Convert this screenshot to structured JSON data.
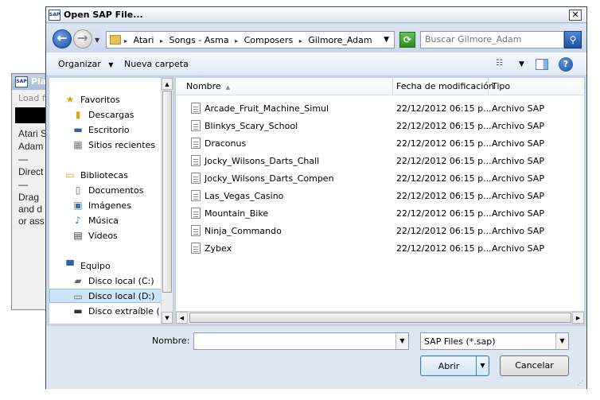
{
  "background_window": {
    "title": "Pla",
    "load_text": "Load fi",
    "lines": [
      "Atari S",
      "Adam",
      "—",
      "Direct",
      "—",
      "Drag",
      "and d",
      "or ass"
    ]
  },
  "dialog": {
    "title": "Open SAP File...",
    "close_glyph": "✕"
  },
  "address": {
    "crumbs": [
      "Atari",
      "Songs - Asma",
      "Composers",
      "Gilmore_Adam"
    ],
    "search_placeholder": "Buscar Gilmore_Adam"
  },
  "toolbar": {
    "organize_label": "Organizar",
    "new_folder_label": "Nueva carpeta"
  },
  "nav": {
    "favorites": "Favoritos",
    "downloads": "Descargas",
    "desktop": "Escritorio",
    "recent": "Sitios recientes",
    "libraries": "Bibliotecas",
    "documents": "Documentos",
    "images": "Imágenes",
    "music": "Música",
    "videos": "Vídeos",
    "computer": "Equipo",
    "disk_c": "Disco local (C:)",
    "disk_d": "Disco local (D:)",
    "removable": "Disco extraíble (H:)"
  },
  "columns": {
    "name": "Nombre",
    "date": "Fecha de modificación",
    "type": "Tipo"
  },
  "files": [
    {
      "name": "Arcade_Fruit_Machine_Simul",
      "date": "22/12/2012 06:15 p...",
      "type": "Archivo SAP"
    },
    {
      "name": "Blinkys_Scary_School",
      "date": "22/12/2012 06:15 p...",
      "type": "Archivo SAP"
    },
    {
      "name": "Draconus",
      "date": "22/12/2012 06:15 p...",
      "type": "Archivo SAP"
    },
    {
      "name": "Jocky_Wilsons_Darts_Chall",
      "date": "22/12/2012 06:15 p...",
      "type": "Archivo SAP"
    },
    {
      "name": "Jocky_Wilsons_Darts_Compen",
      "date": "22/12/2012 06:15 p...",
      "type": "Archivo SAP"
    },
    {
      "name": "Las_Vegas_Casino",
      "date": "22/12/2012 06:15 p...",
      "type": "Archivo SAP"
    },
    {
      "name": "Mountain_Bike",
      "date": "22/12/2012 06:15 p...",
      "type": "Archivo SAP"
    },
    {
      "name": "Ninja_Commando",
      "date": "22/12/2012 06:15 p...",
      "type": "Archivo SAP"
    },
    {
      "name": "Zybex",
      "date": "22/12/2012 06:15 p...",
      "type": "Archivo SAP"
    }
  ],
  "bottom": {
    "filename_label": "Nombre:",
    "filename_value": "",
    "filter_value": "SAP Files (*.sap)",
    "open_label": "Abrir",
    "cancel_label": "Cancelar"
  }
}
